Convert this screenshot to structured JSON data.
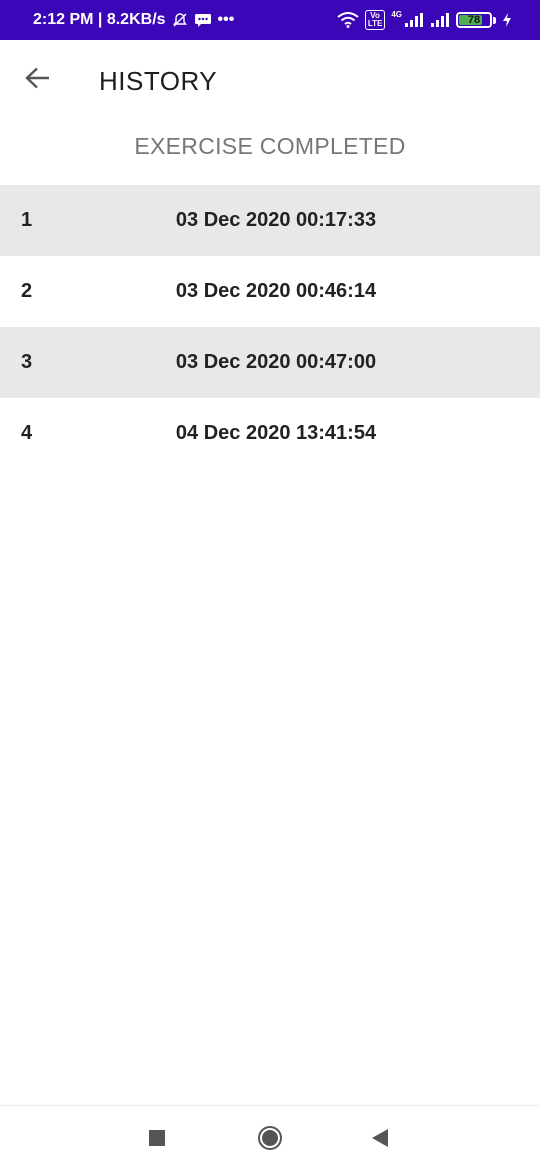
{
  "status_bar": {
    "time_speed": "2:12 PM | 8.2KB/s",
    "more": "•••",
    "volte": "Vo\nLTE",
    "network": "4G",
    "battery_level": "78",
    "battery_fraction": 0.78,
    "icons": [
      "bell-off-icon",
      "message-icon",
      "wifi-icon",
      "signal-icon",
      "battery-icon",
      "charging-icon"
    ],
    "background_color": "#3a06b8"
  },
  "app_bar": {
    "title": "HISTORY",
    "back_icon": "arrow-left-icon"
  },
  "section": {
    "heading": "EXERCISE COMPLETED"
  },
  "history": [
    {
      "index": "1",
      "date": "03 Dec 2020 00:17:33"
    },
    {
      "index": "2",
      "date": "03 Dec 2020 00:46:14"
    },
    {
      "index": "3",
      "date": "03 Dec 2020 00:47:00"
    },
    {
      "index": "4",
      "date": "04 Dec 2020 13:41:54"
    }
  ],
  "nav_bar": {
    "icons": [
      "recents-square-icon",
      "home-circle-icon",
      "back-triangle-icon"
    ]
  }
}
